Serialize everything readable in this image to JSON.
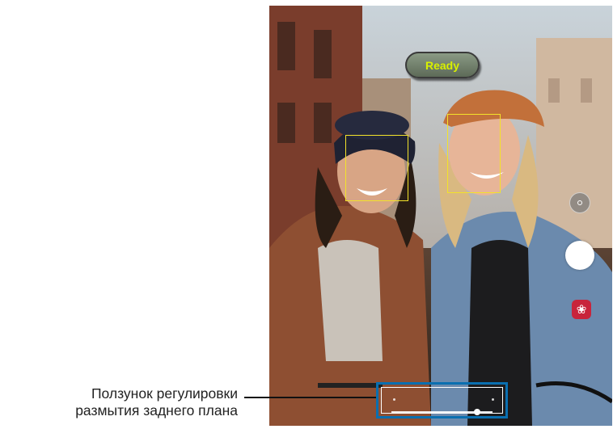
{
  "camera": {
    "ready_label": "Ready",
    "faces_detected": 2,
    "blur_level": 0.85
  },
  "callout": {
    "line1": "Ползунок регулировки",
    "line2": "размытия заднего плана"
  },
  "icons": {
    "switch_camera": "switch-camera-icon",
    "shutter": "shutter-button",
    "effect": "flower-effect-icon"
  },
  "colors": {
    "ready_text": "#d8f000",
    "face_box": "#f3e32a",
    "effect_bg": "#c8243b",
    "highlight": "#0a6fb0"
  }
}
